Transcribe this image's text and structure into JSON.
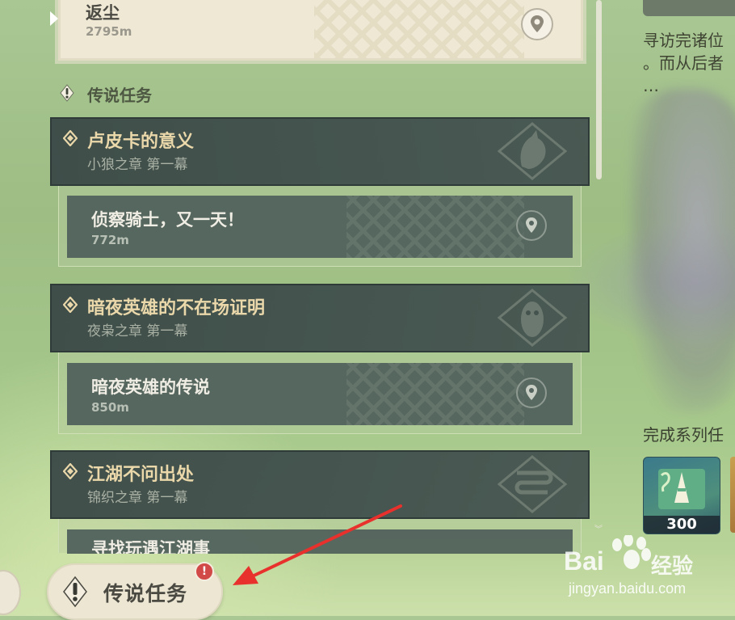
{
  "active_quest": {
    "title": "返尘",
    "distance": "2795m"
  },
  "section": {
    "title": "传说任务"
  },
  "quests": [
    {
      "title": "卢皮卡的意义",
      "chapter": "小狼之章 第一幕",
      "emblem": "wolf-emblem",
      "step": {
        "title": "侦察骑士，又一天！",
        "distance": "772m"
      }
    },
    {
      "title": "暗夜英雄的不在场证明",
      "chapter": "夜枭之章 第一幕",
      "emblem": "owl-emblem",
      "step": {
        "title": "暗夜英雄的传说",
        "distance": "850m"
      }
    },
    {
      "title": "江湖不问出处",
      "chapter": "锦织之章 第一幕",
      "emblem": "scroll-emblem",
      "step": {
        "title": "寻找玩遇江湖事",
        "distance": ""
      }
    }
  ],
  "right_panel": {
    "description_line1": "寻访完诸位",
    "description_line2": "。而从后者",
    "description_line3": "…",
    "series_label": "完成系列任",
    "reward_count": "300"
  },
  "bottom_bar": {
    "legend_button_label": "传说任务",
    "badge": "!"
  },
  "watermark": {
    "brand": "Bai",
    "brand_suffix": "经验",
    "url": "jingyan.baidu.com"
  },
  "colors": {
    "quest_header_bg": "#3a4846",
    "quest_title": "#ead8aa",
    "step_card_bg": "#4e5e5a",
    "active_card_bg": "#efe8d5",
    "badge_red": "#d24a48",
    "arrow_red": "#e8312c"
  }
}
